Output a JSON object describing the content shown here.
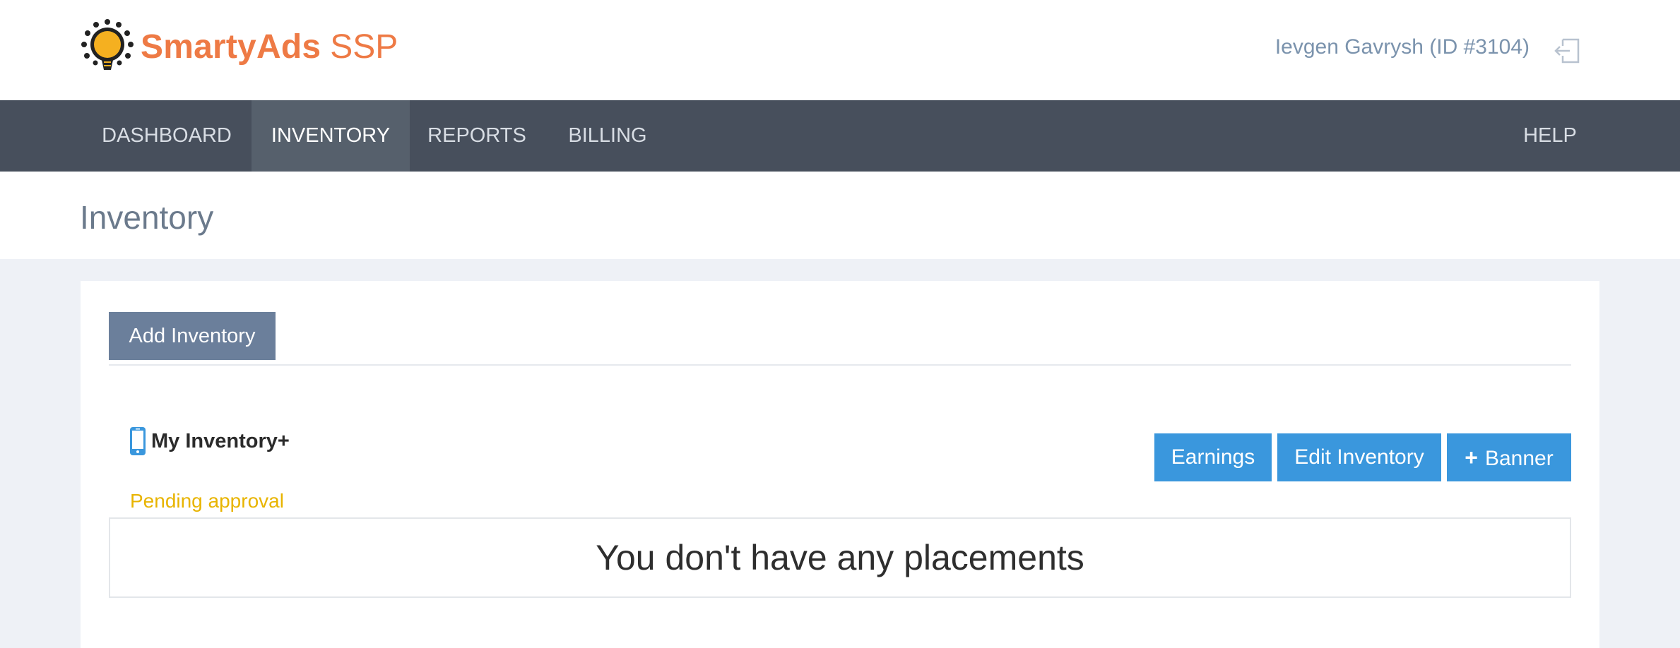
{
  "header": {
    "brand_name": "SmartyAds",
    "brand_suffix": "SSP",
    "user_label": "Ievgen Gavrysh (ID #3104)",
    "logout_icon": "logout-icon",
    "brand_color": "#ee7a45"
  },
  "nav": {
    "items": [
      {
        "label": "DASHBOARD",
        "active": false
      },
      {
        "label": "INVENTORY",
        "active": true
      },
      {
        "label": "REPORTS",
        "active": false
      },
      {
        "label": "BILLING",
        "active": false
      }
    ],
    "help_label": "HELP"
  },
  "page": {
    "title": "Inventory",
    "add_button": "Add Inventory"
  },
  "inventory": {
    "name": "My Inventory+",
    "device_icon": "mobile-phone-icon",
    "status": "Pending approval",
    "status_color": "#e8b400",
    "earnings_button": "Earnings",
    "edit_button": "Edit Inventory",
    "banner_button": "Banner",
    "banner_icon": "plus-icon",
    "empty_message": "You don't have any placements"
  },
  "colors": {
    "nav_bg": "#474f5c",
    "nav_active_bg": "#56606c",
    "primary_button": "#3a97dd",
    "secondary_button": "#6b7f9b",
    "page_bg": "#eef1f6"
  }
}
